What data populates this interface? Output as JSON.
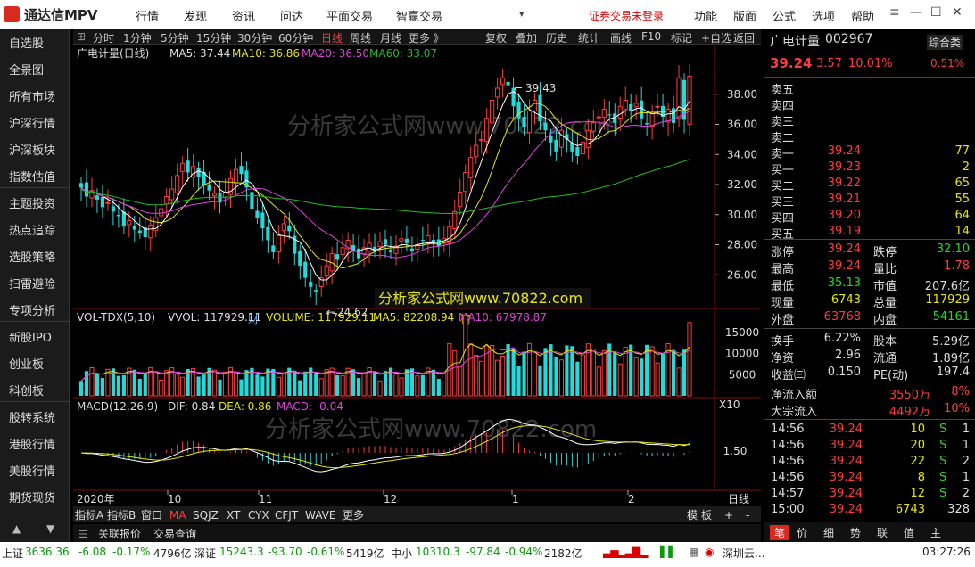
{
  "app": {
    "title": "通达信MPV",
    "not_logged_in": "证券交易未登录"
  },
  "menu": [
    "行情",
    "发现",
    "资讯",
    "问达",
    "平面交易",
    "智赢交易"
  ],
  "menu_right": [
    "功能",
    "版面",
    "公式",
    "选项",
    "帮助"
  ],
  "left_nav": [
    "自选股",
    "全景图",
    "所有市场",
    "沪深行情",
    "沪深板块",
    "指数估值",
    "主题投资",
    "热点追踪",
    "选股策略",
    "扫雷避险",
    "专项分析",
    "新股IPO",
    "创业板",
    "科创板",
    "股转系统",
    "港股行情",
    "美股行情",
    "期货现货"
  ],
  "period_tabs": [
    "分时",
    "1分钟",
    "5分钟",
    "15分钟",
    "30分钟",
    "60分钟",
    "日线",
    "周线",
    "月线",
    "更多 》"
  ],
  "active_period": "日线",
  "tools": [
    "复权",
    "叠加",
    "历史",
    "统计",
    "画线",
    "F10",
    "标记",
    "+自选",
    "返回"
  ],
  "main_panel": {
    "title": "广电计量(日线)",
    "ma5_label": "MA5: 37.44",
    "ma10_label": "MA10: 36.86",
    "ma20_label": "MA20: 36.50",
    "ma60_label": "MA60: 33.07",
    "y_ticks": [
      "38.00",
      "36.00",
      "34.00",
      "32.00",
      "30.00",
      "28.00",
      "26.00"
    ],
    "high_label": "39.43",
    "low_label": "24.62",
    "watermark": "分析家公式网www.70822.com",
    "promo": "分析家公式网www.70822.com",
    "marker_cai": "财",
    "marker_bang": "榜"
  },
  "vol_panel": {
    "title": "VOL-TDX(5,10)",
    "vvol": "VVOL: 117929.11",
    "volume": "VOLUME: 117929.11",
    "ma5": "MA5: 82208.94",
    "ma10": "MA10: 67978.87",
    "y_ticks": [
      "15000",
      "10000",
      "5000"
    ],
    "unit": "X10"
  },
  "macd_panel": {
    "title": "MACD(12,26,9)",
    "dif": "DIF: 0.84",
    "dea": "DEA: 0.86",
    "macd": "MACD: -0.04",
    "y_ticks": [
      "1.50"
    ],
    "watermark": "分析家公式网www.70822.com"
  },
  "x_axis": [
    "2020年",
    "10",
    "11",
    "12",
    "1",
    "2"
  ],
  "x_axis_right": "日线",
  "bottom_tabs": [
    "指标A",
    "指标B",
    "窗口",
    "MA",
    "SQJZ",
    "XT",
    "CYX",
    "CFJT",
    "WAVE",
    "更多"
  ],
  "bottom_right": [
    "模",
    "板",
    "+",
    "-"
  ],
  "subtabs": [
    "关联报价",
    "交易查询"
  ],
  "stock": {
    "name": "广电计量",
    "code": "002967",
    "tag": "综合类",
    "price": "39.24",
    "change": "3.57",
    "pct": "10.01%",
    "extra": "0.51%",
    "asks": [
      [
        "卖五",
        "",
        ""
      ],
      [
        "卖四",
        "",
        ""
      ],
      [
        "卖三",
        "",
        ""
      ],
      [
        "卖二",
        "",
        ""
      ],
      [
        "卖一",
        "39.24",
        "77"
      ]
    ],
    "bids": [
      [
        "买一",
        "39.23",
        "2"
      ],
      [
        "买二",
        "39.22",
        "65"
      ],
      [
        "买三",
        "39.21",
        "55"
      ],
      [
        "买四",
        "39.20",
        "64"
      ],
      [
        "买五",
        "39.19",
        "14"
      ]
    ],
    "stats": [
      [
        "涨停",
        "39.24",
        "跌停",
        "32.10"
      ],
      [
        "最高",
        "39.24",
        "量比",
        "1.78"
      ],
      [
        "最低",
        "35.13",
        "市值",
        "207.6亿"
      ],
      [
        "现量",
        "6743",
        "总量",
        "117929"
      ],
      [
        "外盘",
        "63768",
        "内盘",
        "54161"
      ]
    ],
    "stats2": [
      [
        "换手",
        "6.22%",
        "股本",
        "5.29亿"
      ],
      [
        "净资",
        "2.96",
        "流通",
        "1.89亿"
      ],
      [
        "收益㈢",
        "0.150",
        "PE(动)",
        "197.4"
      ]
    ],
    "flow": [
      [
        "净流入额",
        "3550万",
        "8%"
      ],
      [
        "大宗流入",
        "4492万",
        "10%"
      ]
    ],
    "ticks": [
      [
        "14:56",
        "39.24",
        "10",
        "S",
        "1"
      ],
      [
        "14:56",
        "39.24",
        "20",
        "S",
        "1"
      ],
      [
        "14:56",
        "39.24",
        "22",
        "S",
        "2"
      ],
      [
        "14:56",
        "39.24",
        "8",
        "S",
        "1"
      ],
      [
        "14:57",
        "39.24",
        "12",
        "S",
        "2"
      ],
      [
        "15:00",
        "39.24",
        "6743",
        "",
        "328"
      ]
    ],
    "panel_tabs": [
      "笔",
      "价",
      "细",
      "势",
      "联",
      "值",
      "主"
    ]
  },
  "status": {
    "sh": "上证",
    "sh_val": "3636.36",
    "sh_chg": "-6.08",
    "sh_pct": "-0.17%",
    "sh_amt": "4796亿",
    "sz": "深证",
    "sz_val": "15243.3",
    "sz_chg": "-93.70",
    "sz_pct": "-0.61%",
    "sz_amt": "5419亿",
    "zx": "中小",
    "zx_val": "10310.3",
    "zx_chg": "-97.84",
    "zx_pct": "-0.94%",
    "zx_amt": "2182亿",
    "server": "深圳云...",
    "time": "03:27:26"
  },
  "colors": {
    "up": "#ff3b3b",
    "down": "#23d923",
    "ma5": "#ffffff",
    "ma10": "#e8e800",
    "ma20": "#e040e0",
    "ma60": "#22bb22"
  },
  "chart_data": {
    "type": "candlestick",
    "description_days": "daily candles from Sep 2020 to Feb 2021",
    "ylim": [
      24,
      40
    ],
    "closes": [
      31.8,
      31.2,
      31.6,
      31.0,
      30.5,
      30.8,
      30.2,
      29.9,
      29.2,
      29.6,
      29.0,
      28.8,
      28.5,
      29.3,
      29.8,
      30.4,
      31.2,
      31.7,
      32.6,
      33.4,
      32.8,
      33.2,
      32.5,
      32.0,
      31.6,
      31.4,
      30.8,
      31.5,
      32.4,
      33.0,
      32.7,
      31.8,
      30.4,
      29.8,
      29.1,
      28.3,
      27.5,
      28.6,
      29.4,
      28.9,
      27.4,
      26.6,
      25.8,
      25.2,
      24.9,
      25.8,
      26.6,
      27.4,
      27.0,
      27.8,
      28.3,
      27.6,
      27.1,
      27.8,
      28.1,
      27.6,
      28.2,
      28.0,
      27.5,
      27.9,
      28.4,
      28.1,
      27.6,
      28.0,
      28.3,
      28.6,
      28.1,
      27.9,
      28.4,
      29.2,
      30.2,
      31.5,
      32.8,
      33.8,
      34.6,
      35.0,
      36.4,
      37.6,
      38.4,
      39.1,
      38.6,
      37.2,
      36.4,
      35.8,
      36.9,
      37.6,
      36.2,
      35.6,
      34.8,
      34.2,
      35.6,
      35.0,
      34.2,
      33.9,
      34.8,
      35.6,
      36.1,
      36.5,
      37.0,
      36.6,
      36.1,
      37.2,
      37.6,
      36.9,
      37.4,
      36.4,
      36.0,
      36.8,
      37.2,
      36.5,
      37.0,
      36.1,
      39.1,
      36.3,
      39.2
    ],
    "ma60_end": 33.07
  }
}
